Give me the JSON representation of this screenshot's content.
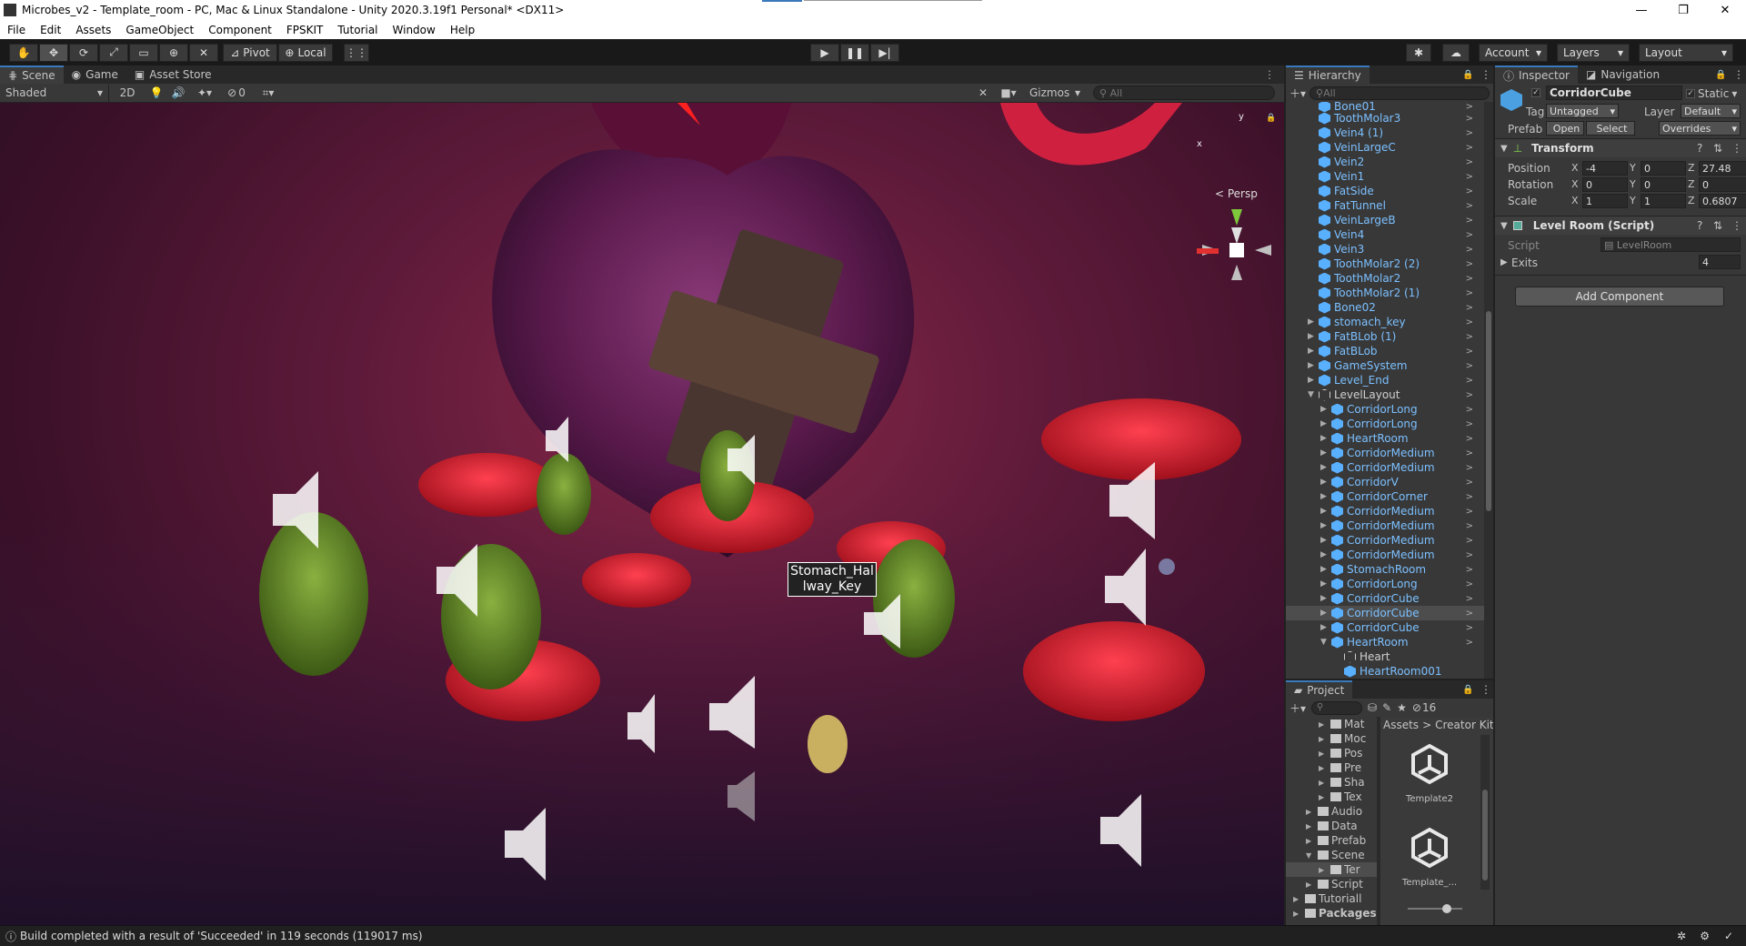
{
  "window": {
    "title": "Microbes_v2 - Template_room - PC, Mac & Linux Standalone - Unity 2020.3.19f1 Personal* <DX11>"
  },
  "menu": [
    "File",
    "Edit",
    "Assets",
    "GameObject",
    "Component",
    "FPSKIT",
    "Tutorial",
    "Window",
    "Help"
  ],
  "toolbar": {
    "pivot": "Pivot",
    "local": "Local",
    "account": "Account",
    "layers": "Layers",
    "layout": "Layout"
  },
  "scene_tabs": {
    "scene": "Scene",
    "game": "Game",
    "asset_store": "Asset Store"
  },
  "scene_toolbar": {
    "shading": "Shaded",
    "mode_2d": "2D",
    "hidden_count": "0",
    "gizmos": "Gizmos",
    "search_placeholder": "All"
  },
  "scene": {
    "persp_label": "< Persp",
    "selected_label": "Stomach_Hallway_Key",
    "gizmo_x": "x",
    "gizmo_y": "y"
  },
  "hierarchy": {
    "title": "Hierarchy",
    "search_placeholder": "All",
    "items": [
      {
        "name": "Bone01",
        "indent": 1,
        "expander": false,
        "selected": false
      },
      {
        "name": "ToothMolar3",
        "indent": 1,
        "expander": false,
        "selected": false
      },
      {
        "name": "Vein4 (1)",
        "indent": 1,
        "expander": false,
        "selected": false
      },
      {
        "name": "VeinLargeC",
        "indent": 1,
        "expander": false,
        "selected": false
      },
      {
        "name": "Vein2",
        "indent": 1,
        "expander": false,
        "selected": false
      },
      {
        "name": "Vein1",
        "indent": 1,
        "expander": false,
        "selected": false
      },
      {
        "name": "FatSide",
        "indent": 1,
        "expander": false,
        "selected": false
      },
      {
        "name": "FatTunnel",
        "indent": 1,
        "expander": false,
        "selected": false
      },
      {
        "name": "VeinLargeB",
        "indent": 1,
        "expander": false,
        "selected": false
      },
      {
        "name": "Vein4",
        "indent": 1,
        "expander": false,
        "selected": false
      },
      {
        "name": "Vein3",
        "indent": 1,
        "expander": false,
        "selected": false
      },
      {
        "name": "ToothMolar2 (2)",
        "indent": 1,
        "expander": false,
        "selected": false
      },
      {
        "name": "ToothMolar2",
        "indent": 1,
        "expander": false,
        "selected": false
      },
      {
        "name": "ToothMolar2 (1)",
        "indent": 1,
        "expander": false,
        "selected": false
      },
      {
        "name": "Bone02",
        "indent": 1,
        "expander": false,
        "selected": false
      },
      {
        "name": "stomach_key",
        "indent": 1,
        "expander": true,
        "selected": false
      },
      {
        "name": "FatBLob (1)",
        "indent": 1,
        "expander": true,
        "selected": false
      },
      {
        "name": "FatBLob",
        "indent": 1,
        "expander": true,
        "selected": false
      },
      {
        "name": "GameSystem",
        "indent": 1,
        "expander": true,
        "selected": false
      },
      {
        "name": "Level_End",
        "indent": 1,
        "expander": true,
        "selected": false
      },
      {
        "name": "LevelLayout",
        "indent": 1,
        "expander": true,
        "selected": false,
        "plain": true
      },
      {
        "name": "CorridorLong",
        "indent": 2,
        "expander": true,
        "selected": false
      },
      {
        "name": "CorridorLong",
        "indent": 2,
        "expander": true,
        "selected": false
      },
      {
        "name": "HeartRoom",
        "indent": 2,
        "expander": true,
        "selected": false
      },
      {
        "name": "CorridorMedium",
        "indent": 2,
        "expander": true,
        "selected": false
      },
      {
        "name": "CorridorMedium",
        "indent": 2,
        "expander": true,
        "selected": false
      },
      {
        "name": "CorridorV",
        "indent": 2,
        "expander": true,
        "selected": false
      },
      {
        "name": "CorridorCorner",
        "indent": 2,
        "expander": true,
        "selected": false
      },
      {
        "name": "CorridorMedium",
        "indent": 2,
        "expander": true,
        "selected": false
      },
      {
        "name": "CorridorMedium",
        "indent": 2,
        "expander": true,
        "selected": false
      },
      {
        "name": "CorridorMedium",
        "indent": 2,
        "expander": true,
        "selected": false
      },
      {
        "name": "CorridorMedium",
        "indent": 2,
        "expander": true,
        "selected": false
      },
      {
        "name": "StomachRoom",
        "indent": 2,
        "expander": true,
        "selected": false
      },
      {
        "name": "CorridorLong",
        "indent": 2,
        "expander": true,
        "selected": false
      },
      {
        "name": "CorridorCube",
        "indent": 2,
        "expander": true,
        "selected": false
      },
      {
        "name": "CorridorCube",
        "indent": 2,
        "expander": true,
        "selected": true
      },
      {
        "name": "CorridorCube",
        "indent": 2,
        "expander": true,
        "selected": false
      },
      {
        "name": "HeartRoom",
        "indent": 2,
        "expander": true,
        "selected": false
      },
      {
        "name": "Heart",
        "indent": 3,
        "expander": false,
        "selected": false,
        "plain": true
      },
      {
        "name": "HeartRoom001",
        "indent": 3,
        "expander": false,
        "selected": false
      }
    ]
  },
  "project": {
    "title": "Project",
    "hidden_count": "16",
    "breadcrumb": [
      "Assets",
      "Creator Kit"
    ],
    "folders": [
      {
        "name": "Mat",
        "indent": 2
      },
      {
        "name": "Moc",
        "indent": 2
      },
      {
        "name": "Pos",
        "indent": 2
      },
      {
        "name": "Pre",
        "indent": 2
      },
      {
        "name": "Sha",
        "indent": 2
      },
      {
        "name": "Tex",
        "indent": 2
      },
      {
        "name": "Audio",
        "indent": 1
      },
      {
        "name": "Data",
        "indent": 1
      },
      {
        "name": "Prefab",
        "indent": 1
      },
      {
        "name": "Scene",
        "indent": 1
      },
      {
        "name": "Ter",
        "indent": 2
      },
      {
        "name": "Script",
        "indent": 1
      },
      {
        "name": "Tutoriall",
        "indent": 0
      },
      {
        "name": "Packages",
        "indent": -1
      }
    ],
    "assets": [
      {
        "name": "Template2"
      },
      {
        "name": "Template_..."
      }
    ]
  },
  "inspector": {
    "tabs": [
      "Inspector",
      "Navigation"
    ],
    "object_name": "CorridorCube",
    "static_label": "Static",
    "tag_label": "Tag",
    "tag_value": "Untagged",
    "layer_label": "Layer",
    "layer_value": "Default",
    "prefab_label": "Prefab",
    "open": "Open",
    "select": "Select",
    "overrides": "Overrides",
    "transform": {
      "title": "Transform",
      "position": {
        "label": "Position",
        "x": "-4",
        "y": "0",
        "z": "27.48"
      },
      "rotation": {
        "label": "Rotation",
        "x": "0",
        "y": "0",
        "z": "0"
      },
      "scale": {
        "label": "Scale",
        "x": "1",
        "y": "1",
        "z": "0.6807"
      }
    },
    "script_component": {
      "title": "Level Room (Script)",
      "script_label": "Script",
      "script_value": "LevelRoom",
      "exits_label": "Exits",
      "exits_value": "4"
    },
    "add_component": "Add Component"
  },
  "status": {
    "message": "Build completed with a result of 'Succeeded' in 119 seconds (119017 ms)"
  },
  "colors": {
    "accent": "#3a79bb",
    "link_blue": "#58b0ff",
    "panel": "#383838",
    "bg": "#202020"
  }
}
